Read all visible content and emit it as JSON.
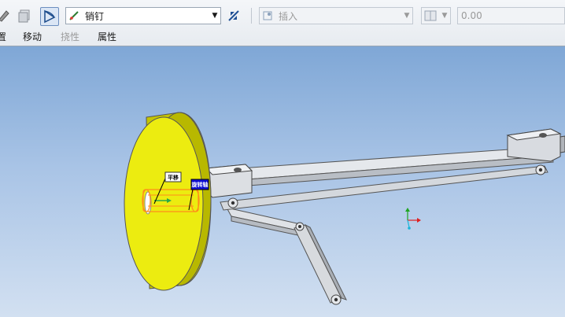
{
  "toolbar": {
    "connection_type": "销钉",
    "insert_placeholder": "插入",
    "value_field": "0.00"
  },
  "tabs": [
    {
      "label": "置"
    },
    {
      "label": "移动"
    },
    {
      "label": "挠性"
    },
    {
      "label": "属性"
    }
  ],
  "viewport": {
    "callout_1": "平移",
    "callout_2": "旋转轴"
  },
  "colors": {
    "wheel": "#e8e800",
    "link": "#d9dde2",
    "highlight": "#ff8c1a",
    "selected_tag": "#1010d0"
  }
}
